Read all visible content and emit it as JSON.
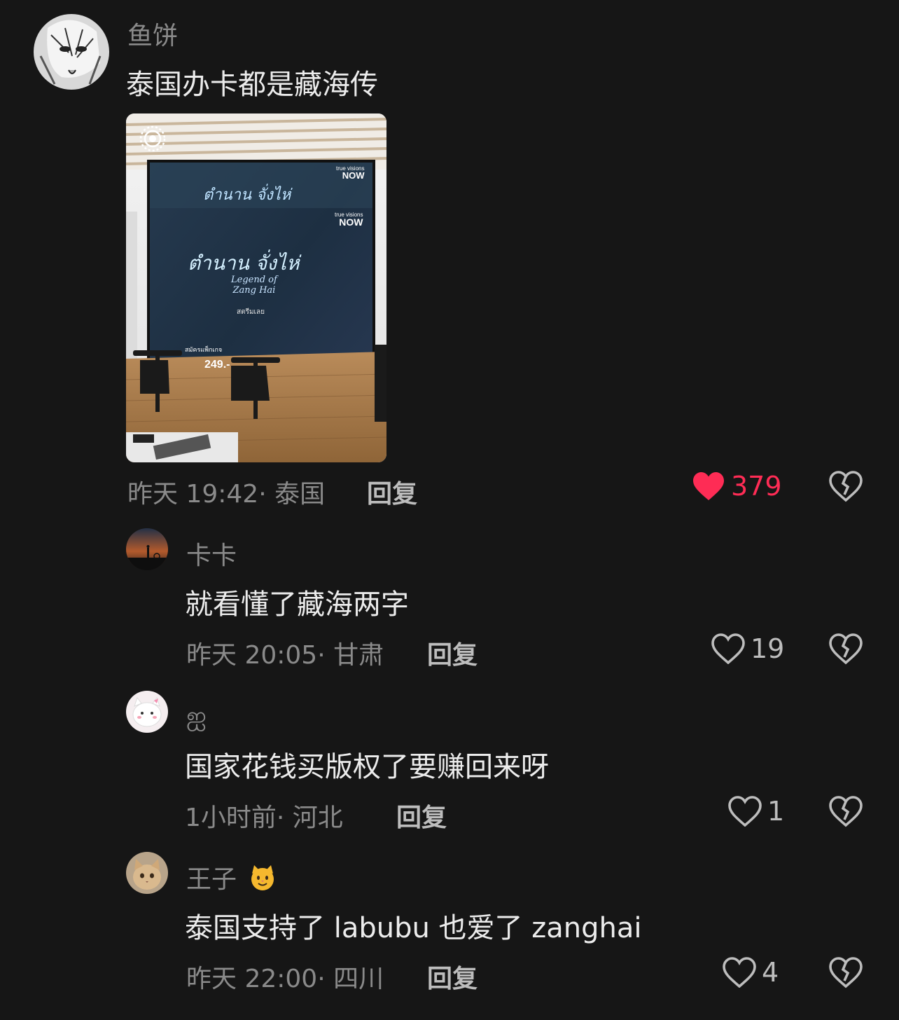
{
  "comments": [
    {
      "username": "鱼饼",
      "text": "泰国办卡都是藏海传",
      "time": "昨天 19:42",
      "location": "· 泰国",
      "reply_label": "回复",
      "like_count": "379",
      "liked": true,
      "image": {
        "screen_text_thai": "ตำนาน จั่งไห่",
        "screen_text_en_1": "Legend of",
        "screen_text_en_2": "Zang Hai",
        "screen_sub": "สตรีมเลย",
        "brand_small": "true visions",
        "brand_now": "NOW",
        "promo_line": "สมัครแพ็กเกจ",
        "promo_price": "249.-"
      }
    },
    {
      "username": "卡卡",
      "text": "就看懂了藏海两字",
      "time": "昨天 20:05",
      "location": "· 甘肃",
      "reply_label": "回复",
      "like_count": "19",
      "liked": false
    },
    {
      "username": "ஐ",
      "text": "国家花钱买版权了要赚回来呀",
      "time": "1小时前",
      "location": "· 河北",
      "reply_label": "回复",
      "like_count": "1",
      "liked": false
    },
    {
      "username": "王子",
      "username_emoji": "🐱",
      "text": "泰国支持了 labubu 也爱了 zanghai",
      "time": "昨天 22:00",
      "location": "· 四川",
      "reply_label": "回复",
      "like_count": "4",
      "liked": false
    }
  ],
  "colors": {
    "background": "#161616",
    "like_active": "#fe2c55",
    "muted_text": "#8a8a8a"
  }
}
